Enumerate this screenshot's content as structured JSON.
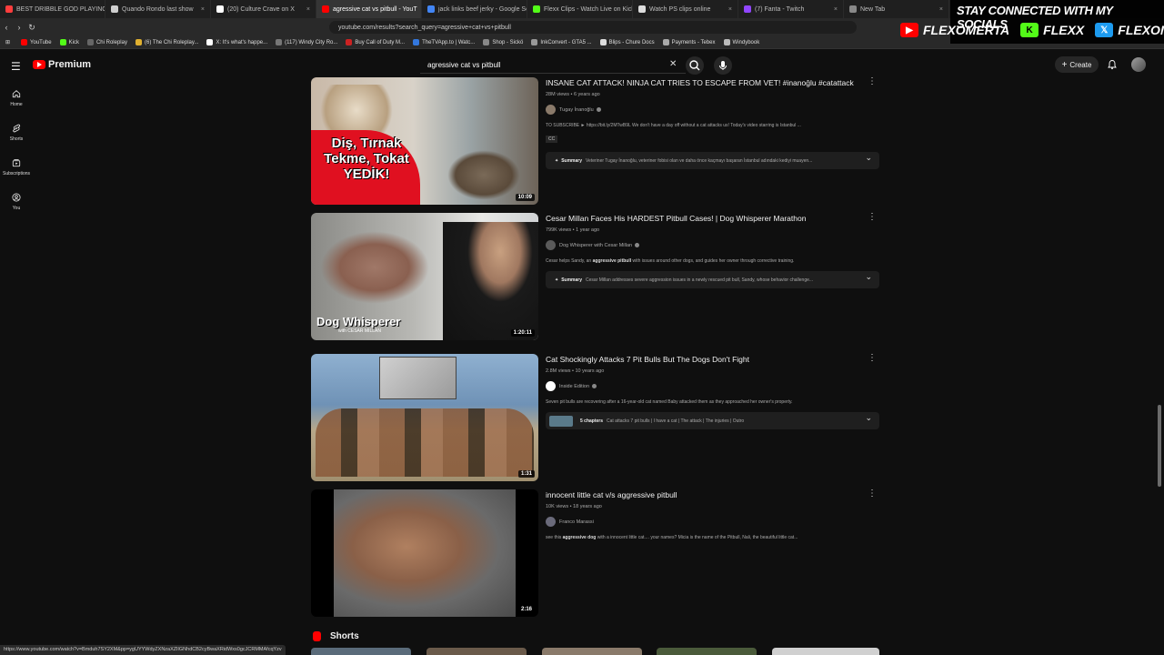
{
  "browser": {
    "tabs": [
      {
        "label": "BEST DRIBBLE GOD PLAYING",
        "color": "#ff3d3d",
        "active": false
      },
      {
        "label": "Quando Rondo last show",
        "color": "#cfcfcf",
        "active": false
      },
      {
        "label": "(20) Culture Crave on X",
        "color": "#ffffff",
        "active": false
      },
      {
        "label": "agressive cat vs pitbull - YouT",
        "color": "#ff0000",
        "active": true
      },
      {
        "label": "jack links beef jerky - Google Sea",
        "color": "#4285f4",
        "active": false
      },
      {
        "label": "Flexx Clips - Watch Live on Kick",
        "color": "#53fc18",
        "active": false
      },
      {
        "label": "Watch PS clips online",
        "color": "#dddddd",
        "active": false
      },
      {
        "label": "(7) Fanta - Twitch",
        "color": "#9146ff",
        "active": false
      },
      {
        "label": "New Tab",
        "color": "#888888",
        "active": false
      }
    ],
    "url": "youtube.com/results?search_query=agressive+cat+vs+pitbull",
    "bookmarks": [
      {
        "label": "YouTube",
        "color": "#ff0000"
      },
      {
        "label": "Kick",
        "color": "#53fc18"
      },
      {
        "label": "Chi Roleplay",
        "color": "#666666"
      },
      {
        "label": "(6) The Chi Roleplay...",
        "color": "#e0b030"
      },
      {
        "label": "X: It's what's happe...",
        "color": "#ffffff"
      },
      {
        "label": "(117) Windy City Ro...",
        "color": "#777777"
      },
      {
        "label": "Buy Call of Duty M...",
        "color": "#cc2222"
      },
      {
        "label": "TheTVApp.to | Watc...",
        "color": "#3377dd"
      },
      {
        "label": "Shop - Sickö",
        "color": "#888888"
      },
      {
        "label": "InkConvert - GTA5 ...",
        "color": "#999999"
      },
      {
        "label": "Blips - Chure Docs",
        "color": "#dddddd"
      },
      {
        "label": "Payments - Tebex",
        "color": "#aaaaaa"
      },
      {
        "label": "Windybook",
        "color": "#bbbbbb"
      }
    ],
    "status_url": "https://www.youtube.com/watch?v=Bmduh7SY2XM&pp=ygUYYWdyZXNzaXZlIGNhdCB2cyBwaXRidWxs0gcJCRMMAfcqYzv"
  },
  "overlay": {
    "title": "STAY CONNECTED WITH MY SOCIALS",
    "socials": [
      {
        "name": "FLEXOMERTA",
        "icon": "youtube-icon",
        "color": "#ff0000",
        "glyph": "▶"
      },
      {
        "name": "FLEXX",
        "icon": "kick-icon",
        "color": "#53fc18",
        "glyph": "K"
      },
      {
        "name": "FLEXOMERTA",
        "icon": "x-icon",
        "color": "#1d9bf0",
        "glyph": "𝕏"
      }
    ]
  },
  "youtube": {
    "brand": "Premium",
    "search_query": "agressive cat vs pitbull",
    "create_label": "Create",
    "sidebar": [
      {
        "label": "Home",
        "icon": "home-icon"
      },
      {
        "label": "Shorts",
        "icon": "shorts-icon"
      },
      {
        "label": "Subscriptions",
        "icon": "subscriptions-icon"
      },
      {
        "label": "You",
        "icon": "you-icon"
      }
    ],
    "results": [
      {
        "title": "INSANE CAT ATTACK! NINJA CAT TRIES TO ESCAPE FROM VET! #inanoğlu #catattack",
        "meta": "28M views • 6 years ago",
        "channel": "Tugay İnanoğlu",
        "verified": true,
        "desc_pre": "TO SUBSCRIBE ► https://bit.ly/2MTwB9L We don't have a day off without a cat attacks us! Today's video starring is İstanbul ...",
        "desc_bold": "",
        "desc_post": "",
        "cc": "CC",
        "summary_label": "Summary",
        "summary": "Veteriner Tugay İnanoğlu, veteriner fobisi olan ve daha önce kaçmayı başaran İstanbul adındaki kediyi muayen...",
        "duration": "10:09",
        "thumb_overlay": "Diş, Tırnak\nTekme, Tokat\nYEDİK!"
      },
      {
        "title": "Cesar Millan Faces His HARDEST Pitbull Cases! | Dog Whisperer Marathon",
        "meta": "799K views • 1 year ago",
        "channel": "Dog Whisperer with Cesar Millan",
        "verified": true,
        "desc_pre": "Cesar helps Sandy, an ",
        "desc_bold": "aggressive pitbull",
        "desc_post": " with issues around other dogs, and guides her owner through corrective training.",
        "summary_label": "Summary",
        "summary": "Cesar Millan addresses severe aggression issues in a newly rescued pit bull, Sandy, whose behavior challenge...",
        "duration": "1:20:11",
        "thumb_overlay": "Dog Whisperer",
        "thumb_sub": "with CESAR MILLAN"
      },
      {
        "title": "Cat Shockingly Attacks 7 Pit Bulls But The Dogs Don't Fight",
        "meta": "2.8M views • 10 years ago",
        "channel": "Inside Edition",
        "verified": true,
        "desc_pre": "Seven pit bulls are recovering after a 16-year-old cat named Baby attacked them as they approached her owner's property.",
        "desc_bold": "",
        "desc_post": "",
        "chapters_label": "5 chapters",
        "chapters": "Cat attacks 7 pit bulls | I have a cat | The attack | The injuries | Outro",
        "duration": "1:31"
      },
      {
        "title": "innocent little cat v/s aggressive pitbull",
        "meta": "10K views • 18 years ago",
        "channel": "Franco Marassi",
        "verified": false,
        "desc_pre": "see this ",
        "desc_bold": "aggressive dog",
        "desc_post": " with a innocent little cat.... your names? Micia is the name of the Pitbull, Nali, the beautiful little cat...",
        "duration": "2:16"
      }
    ],
    "shorts_label": "Shorts"
  }
}
